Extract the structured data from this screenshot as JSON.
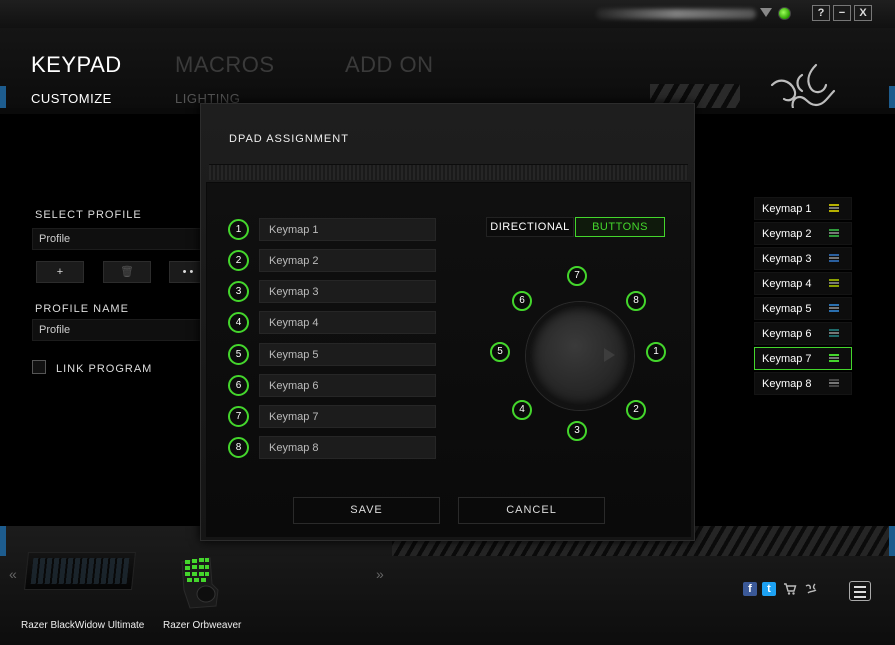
{
  "window": {
    "help": "?",
    "minimize": "−",
    "close": "X"
  },
  "nav": {
    "tabs": [
      "KEYPAD",
      "MACROS",
      "ADD ON"
    ],
    "subtabs": [
      "CUSTOMIZE",
      "LIGHTING"
    ]
  },
  "profile": {
    "select_label": "SELECT PROFILE",
    "selected": "Profile",
    "add": "+",
    "delete": "🗑",
    "more": "• •",
    "name_label": "PROFILE NAME",
    "name_value": "Profile",
    "link_program": "LINK PROGRAM"
  },
  "keymaps": [
    {
      "label": "Keymap 1",
      "color": "#b5b000"
    },
    {
      "label": "Keymap 2",
      "color": "#2e9a3a"
    },
    {
      "label": "Keymap 3",
      "color": "#2a5f9e"
    },
    {
      "label": "Keymap 4",
      "color": "#8aa000"
    },
    {
      "label": "Keymap 5",
      "color": "#2a6fae"
    },
    {
      "label": "Keymap 6",
      "color": "#1e6a6a"
    },
    {
      "label": "Keymap 7",
      "color": "#44d62c"
    },
    {
      "label": "Keymap 8",
      "color": "#444444"
    }
  ],
  "selected_keymap": "Keymap 7",
  "dialog": {
    "title": "DPAD ASSIGNMENT",
    "rows": [
      {
        "num": "1",
        "value": "Keymap 1"
      },
      {
        "num": "2",
        "value": "Keymap 2"
      },
      {
        "num": "3",
        "value": "Keymap 3"
      },
      {
        "num": "4",
        "value": "Keymap 4"
      },
      {
        "num": "5",
        "value": "Keymap 5"
      },
      {
        "num": "6",
        "value": "Keymap 6"
      },
      {
        "num": "7",
        "value": "Keymap 7"
      },
      {
        "num": "8",
        "value": "Keymap 8"
      }
    ],
    "mode_directional": "DIRECTIONAL",
    "mode_buttons": "BUTTONS",
    "active_mode": "BUTTONS",
    "dpad": [
      "1",
      "2",
      "3",
      "4",
      "5",
      "6",
      "7",
      "8"
    ],
    "save": "SAVE",
    "cancel": "CANCEL"
  },
  "devices": [
    {
      "label": "Razer BlackWidow Ultimate"
    },
    {
      "label": "Razer Orbweaver"
    }
  ],
  "bottom": {
    "prev": "«",
    "next": "»",
    "social": [
      "facebook-icon",
      "twitter-icon",
      "store-icon",
      "razer-icon"
    ],
    "accent": "#44d62c"
  }
}
